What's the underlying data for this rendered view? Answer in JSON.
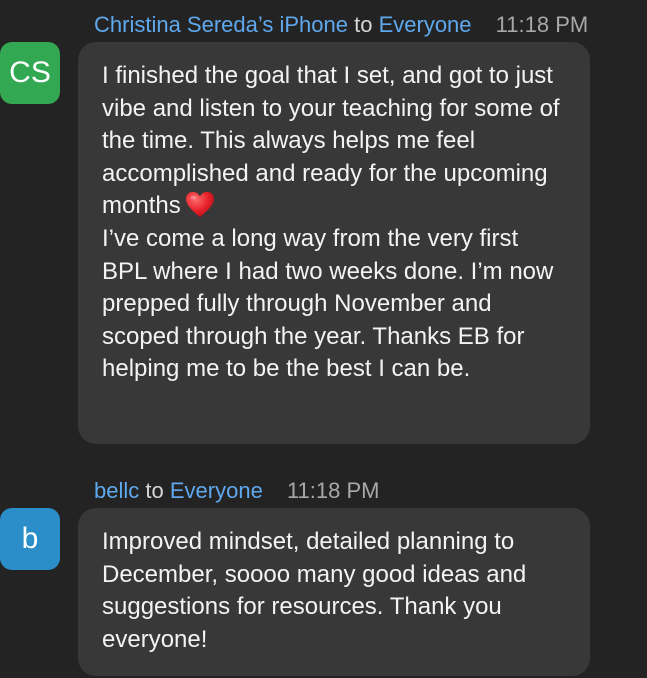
{
  "messages": [
    {
      "sender": "Christina Sereda’s iPhone",
      "to_word": "to",
      "recipient": "Everyone",
      "time": "11:18 PM",
      "avatar_initials": "CS",
      "avatar_color": "#33a852",
      "text_part1": "I finished the goal that I set, and got to just vibe and listen to your teaching for some of the time. This always helps me feel accomplished and ready for the upcoming months",
      "emoji": "red-heart-icon",
      "text_part2": "I’ve come a long way from the very first BPL where I had two weeks done. I’m now prepped fully through November and scoped through the year. Thanks EB for helping me to be the best I can be."
    },
    {
      "sender": "bellc",
      "to_word": "to",
      "recipient": "Everyone",
      "time": "11:18 PM",
      "avatar_initials": "b",
      "avatar_color": "#2c8ec9",
      "text": "Improved mindset, detailed planning to December, soooo many good ideas and suggestions for resources. Thank you everyone!"
    }
  ],
  "colors": {
    "background": "#232323",
    "bubble": "#383838",
    "link_blue": "#5fa8ee",
    "timestamp": "#a8a8a8"
  }
}
